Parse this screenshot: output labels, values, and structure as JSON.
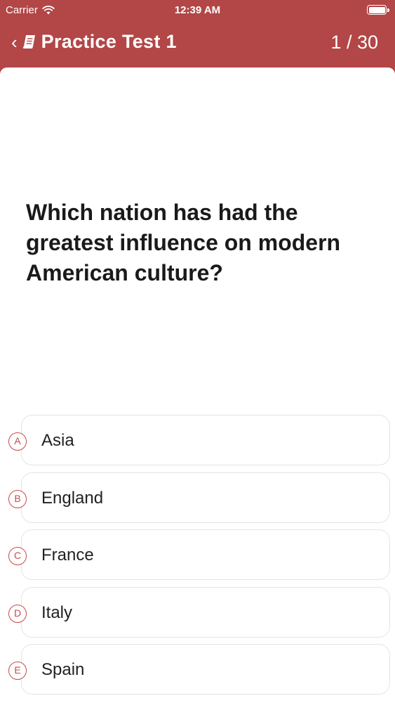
{
  "status_bar": {
    "carrier": "Carrier",
    "time": "12:39 AM"
  },
  "nav": {
    "title": "Practice Test 1",
    "counter": "1 / 30"
  },
  "question": {
    "text": "Which nation has had the greatest influence on modern American culture?"
  },
  "options": [
    {
      "letter": "A",
      "text": "Asia"
    },
    {
      "letter": "B",
      "text": "England"
    },
    {
      "letter": "C",
      "text": "France"
    },
    {
      "letter": "D",
      "text": "Italy"
    },
    {
      "letter": "E",
      "text": "Spain"
    }
  ],
  "colors": {
    "header_bg": "#b34646",
    "accent": "#c94a4a",
    "card_bg": "#ffffff"
  }
}
